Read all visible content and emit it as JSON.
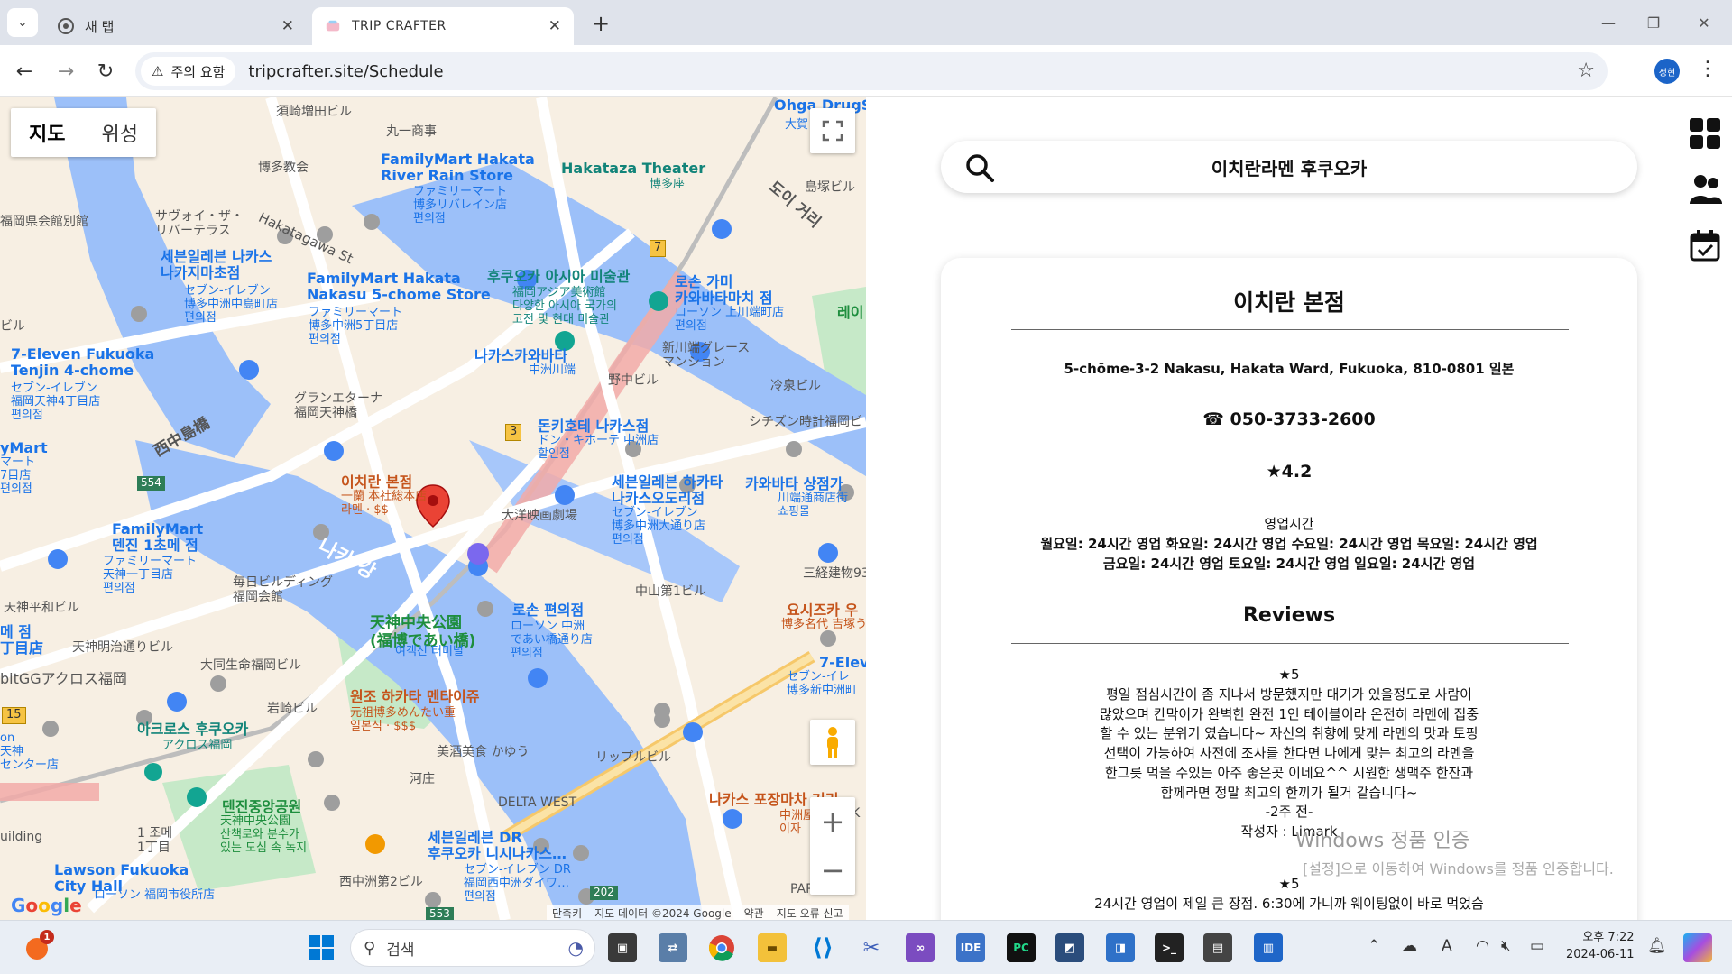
{
  "browser": {
    "tabs": [
      {
        "title": "새 탭",
        "icon": "chrome-icon"
      },
      {
        "title": "TRIP CRAFTER",
        "icon": "tripcrafter-favicon"
      }
    ],
    "security_label": "주의 요함",
    "url": "tripcrafter.site/Schedule",
    "profile_initials": "정현"
  },
  "map": {
    "type_buttons": [
      "지도",
      "위성"
    ],
    "selected_type": "지도",
    "footer": [
      "단축키",
      "지도 데이터 ©2024 Google",
      "약관",
      "지도 오류 신고"
    ],
    "selected_place_label": "이치란 본점",
    "labels": {
      "l01": "須崎増田ビル",
      "l02": "丸一商事",
      "l03": "博多教会",
      "l04": "FamilyMart Hakata\nRiver Rain Store",
      "l05": "ファミリーマート\n博多リバレイン店\n편의점",
      "l06": "Hakataza Theater",
      "l07": "博多座",
      "l08": "島塚ビル",
      "l09": "도이 거리",
      "l10": "Ohga DrugSto",
      "l11": "大賀",
      "l12": "福岡県会館別館",
      "l13": "サヴォイ・ザ・\nリバーテラス",
      "l14": "Hakatagawa St",
      "l15": "세븐일레븐 나카스\n나카지마초점",
      "l16": "セブン-イレブン\n博多中洲中島町店\n편의점",
      "l17": "FamilyMart Hakata\nNakasu 5-chome Store",
      "l18": "ファミリーマート\n博多中洲5丁目店\n편의점",
      "l19": "후쿠오카 아시아 미술관",
      "l20": "福岡アジア美術館\n다양한 아시아 국가의\n고전 및 현대 미술관",
      "l21": "로손 가미\n카와바타마치 점",
      "l22": "ローソン 上川端町店\n편의점",
      "l23": "레이",
      "l24": "7-Eleven Fukuoka\nTenjin 4-chome",
      "l25": "セブン-イレブン\n福岡天神4丁目店\n편의점",
      "l26": "나카스카와바타",
      "l27": "中洲川端",
      "l28": "新川端グレース\nマンション",
      "l29": "野中ビル",
      "l30": "冷泉ビル",
      "l31": "グランエターナ\n福岡天神橋",
      "l32": "西中島橋",
      "l33": "돈키호테 나카스점",
      "l34": "ドン・キホーテ 中洲店\n할인점",
      "l35": "シチズン時計福岡ビ",
      "l36": "yMart",
      "l37": "マート\n7目店\n편의점",
      "l38": "一蘭 本社総本店\n라멘 · $$",
      "l39": "세븐일레븐 하카타\n나카스오도리점",
      "l40": "セブン-イレブン\n博多中洲大通り店\n편의점",
      "l41": "카와바타 상점가",
      "l42": "川端通商店街\n쇼핑몰",
      "l43": "大洋映画劇場",
      "l44": "FamilyMart\n덴진 1초메 점",
      "l45": "ファミリーマート\n天神一丁目店\n편의점",
      "l46": "나카 강",
      "l47": "毎日ビルディング\n福岡会館",
      "l48": "三経建物93",
      "l49": "中山第1ビル",
      "l50": "요시즈카 우",
      "l51": "博多名代 吉塚う",
      "l52": "天神平和ビル",
      "l53": "메 점\n丁目店",
      "l54": "天神明治通りビル",
      "l55": "天神中央公園\n(福博であい橋)",
      "l56": "여객선 터미널",
      "l57": "로손 편의점",
      "l58": "ローソン 中洲\nであい橋通り店\n편의점",
      "l59": "7-Elev",
      "l60": "セブン-イレ\n博多新中洲町",
      "l61": "bitGGアクロス福岡",
      "l62": "大同生命福岡ビル",
      "l63": "원조 하카타 멘타이쥬",
      "l64": "元祖博多めんたい重\n일본식 · $$$",
      "l65": "岩崎ビル",
      "l66": "아크로스 후쿠오카",
      "l67": "アクロス福岡",
      "l68": "美酒美食 かゆう",
      "l69": "リップルビル",
      "l70": "河庄",
      "l71": "DELTA WEST",
      "l72": "나카스 포장마차 거리",
      "l73": "中洲屋\n이자",
      "l74": "덴진중앙공원",
      "l75": "天神中央公園\n산책로와 분수가\n있는 도심 속 녹지",
      "l76": "1 조메\n1丁目",
      "l77": "Lawson Fukuoka\nCity Hall",
      "l78": "ローソン 福岡市役所店",
      "l79": "세븐일레븐 DR\n후쿠오카 니시나카스…",
      "l80": "セブン-イレブン DR\n福岡西中洲ダイワ…\n편의점",
      "l81": "西中洲第2ビル",
      "l82": "PAR",
      "l83": "uilding",
      "l84": "on\n天神\nセンター店",
      "l85": "ビル",
      "l86": "JK"
    },
    "road_shields": [
      "7",
      "3",
      "554",
      "15",
      "202",
      "553"
    ]
  },
  "app": {
    "search_query": "이치란라멘 후쿠오카",
    "place": {
      "name": "이치란 본점",
      "address": "5-chōme-3-2 Nakasu, Hakata Ward, Fukuoka, 810-0801 일본",
      "phone": "☎ 050-3733-2600",
      "rating": "★4.2",
      "hours_label": "영업시간",
      "hours_line1": "월요일: 24시간 영업 화요일: 24시간 영업 수요일: 24시간 영업 목요일: 24시간 영업",
      "hours_line2": "금요일: 24시간 영업 토요일: 24시간 영업 일요일: 24시간 영업"
    },
    "reviews_title": "Reviews",
    "reviews": [
      {
        "stars": "★5",
        "text": "평일 점심시간이 좀 지나서 방문했지만 대기가 있을정도로 사람이\n많았으며 칸막이가 완벽한 완전 1인 테이블이라 온전히 라멘에 집중\n할 수 있는 분위기 였습니다~ 자신의 취향에 맞게 라멘의 맛과 토핑\n선택이 가능하여 사전에 조사를 한다면 나에게 맞는 최고의 라멘을\n한그릇 먹을 수있는 아주 좋은곳 이네요^^ 시원한 생맥주 한잔과\n함께라면 정말 최고의 한끼가 될거 같습니다~",
        "time": "-2주 전-",
        "author": "작성자 : Limark"
      },
      {
        "stars": "★5",
        "text": "24시간 영업이 제일 큰 장점. 6:30에 가니까 웨이팅없이 바로 먹었슴",
        "time": "",
        "author": ""
      }
    ],
    "watermark_title": "Windows 정품 인증",
    "watermark_sub": "[설정]으로 이동하여 Windows를 정품 인증합니다."
  },
  "taskbar": {
    "search_label": "검색",
    "notification_badge": "1",
    "time": "오후 7:22",
    "date": "2024-06-11",
    "pinned": [
      "file-explorer",
      "remote-desktop",
      "chrome",
      "folder",
      "vscode",
      "snipping-tool",
      "visual-studio",
      "ide",
      "pycharm",
      "app",
      "app2",
      "terminal",
      "server-console",
      "notepad"
    ]
  },
  "colors": {
    "water": "#9cc0f9",
    "park": "#c6e9c8",
    "road": "#ffffff",
    "rail": "#ef9a9a",
    "pin": "#ea4335",
    "accent": "#1a73e8"
  }
}
